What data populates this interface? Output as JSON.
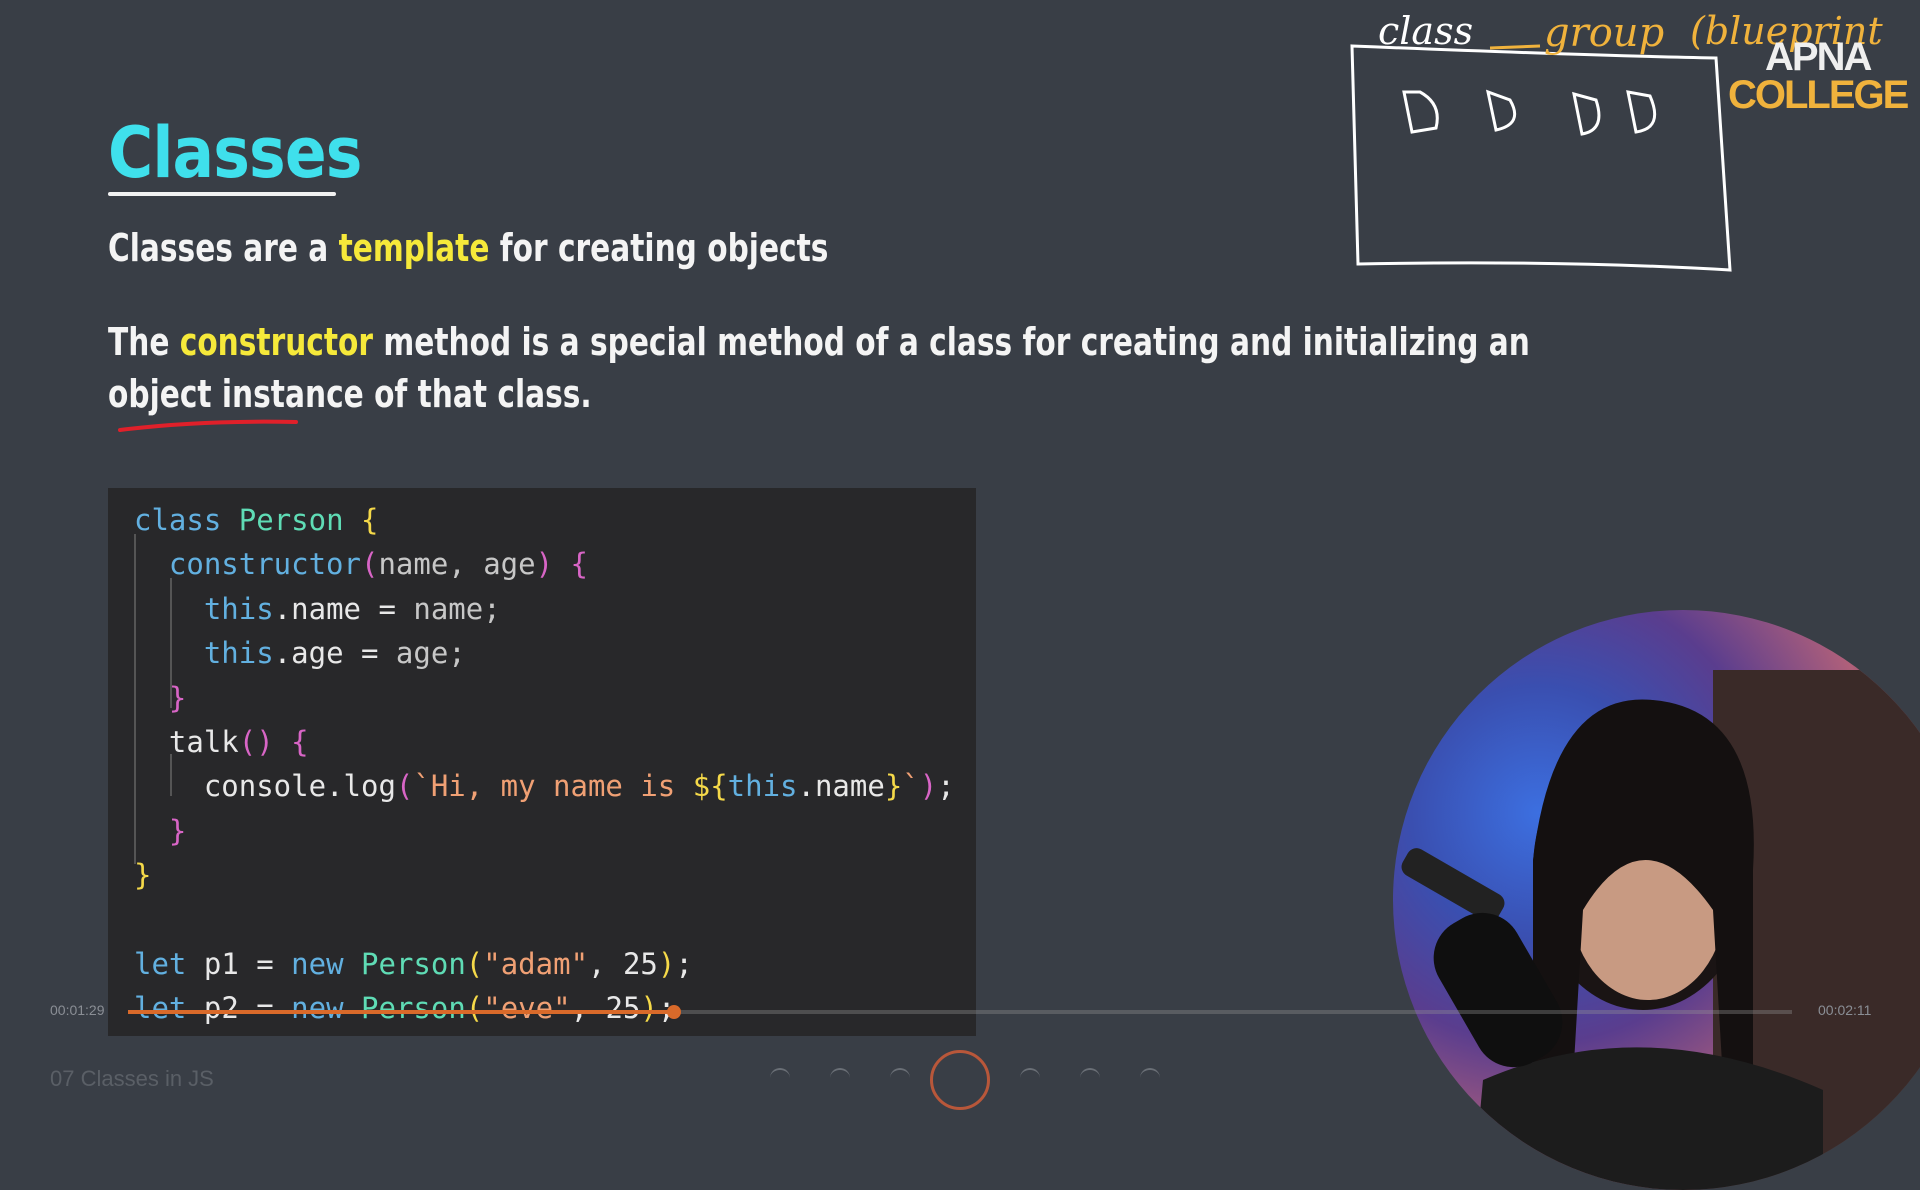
{
  "slide": {
    "title": "Classes",
    "line1": {
      "prefix": "Classes are a ",
      "highlight": "template",
      "suffix": " for creating objects"
    },
    "line2": {
      "prefix": "The ",
      "highlight": "constructor",
      "rest1": " method is a special method of a class for creating and initializing an",
      "rest2": "object instance of that class."
    }
  },
  "code": {
    "lines": [
      "class Person {",
      "  constructor(name, age) {",
      "    this.name = name;",
      "    this.age = age;",
      "  }",
      "  talk() {",
      "    console.log(`Hi, my name is ${this.name}`);",
      "  }",
      "}",
      "",
      "let p1 = new Person(\"adam\", 25);",
      "let p2 = new Person(\"eve\", 25);"
    ]
  },
  "logo": {
    "line1": "APNA",
    "line2": "COLLEGE"
  },
  "annotation": {
    "word1": "class",
    "word2": "group",
    "word3": "(blueprint"
  },
  "video": {
    "time_current": "00:01:29",
    "time_total": "00:02:11",
    "progress_fraction": 0.328,
    "title": "07 Classes in JS"
  },
  "colors": {
    "accent_title": "#3fe0ec",
    "highlight": "#f6e93a",
    "brand_orange": "#f0b23c",
    "progress": "#d96a2a"
  }
}
